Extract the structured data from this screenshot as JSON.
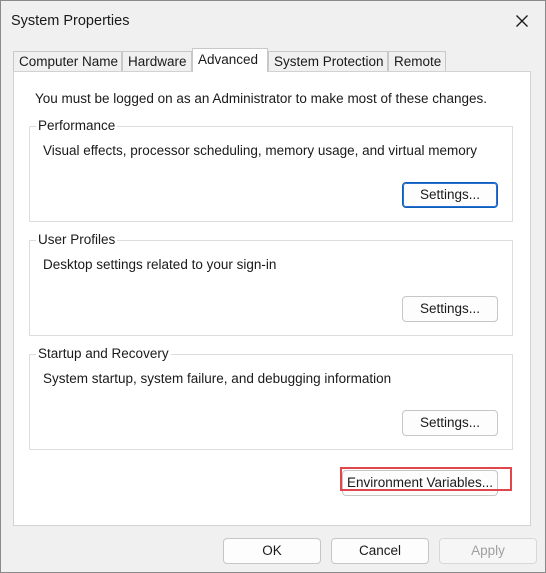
{
  "window": {
    "title": "System Properties",
    "close_icon": "close-icon"
  },
  "tabs": [
    {
      "label": "Computer Name",
      "active": false
    },
    {
      "label": "Hardware",
      "active": false
    },
    {
      "label": "Advanced",
      "active": true
    },
    {
      "label": "System Protection",
      "active": false
    },
    {
      "label": "Remote",
      "active": false
    }
  ],
  "advanced": {
    "admin_notice": "You must be logged on as an Administrator to make most of these changes.",
    "performance": {
      "title": "Performance",
      "description": "Visual effects, processor scheduling, memory usage, and virtual memory",
      "button_label": "Settings..."
    },
    "user_profiles": {
      "title": "User Profiles",
      "description": "Desktop settings related to your sign-in",
      "button_label": "Settings..."
    },
    "startup_recovery": {
      "title": "Startup and Recovery",
      "description": "System startup, system failure, and debugging information",
      "button_label": "Settings..."
    },
    "env_button_label": "Environment Variables...",
    "highlight_color": "#e0474c"
  },
  "footer": {
    "ok_label": "OK",
    "cancel_label": "Cancel",
    "apply_label": "Apply"
  }
}
